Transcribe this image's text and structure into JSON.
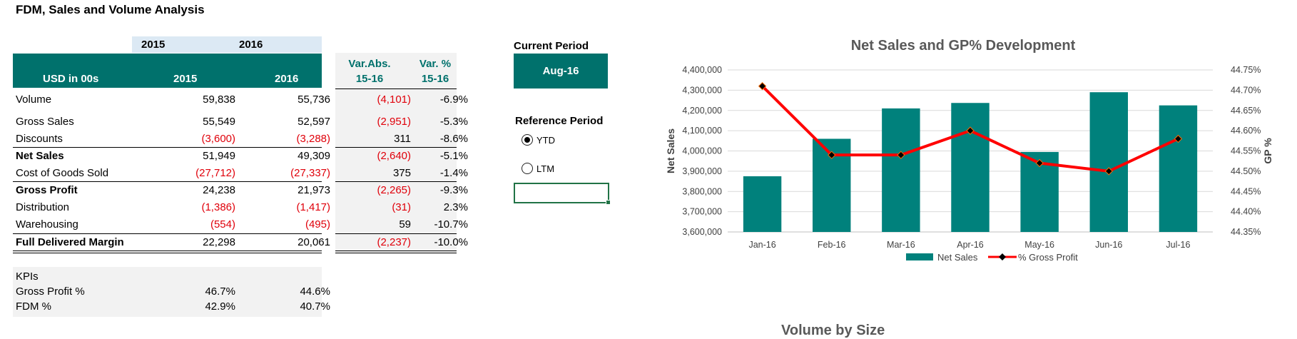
{
  "title": "FDM, Sales and Volume Analysis",
  "years": [
    "2015",
    "2016"
  ],
  "table": {
    "header": {
      "label": "USD in 00s",
      "col2015": "2015",
      "col2016": "2016"
    },
    "rows": [
      {
        "label": "Volume",
        "v2015": "59,838",
        "v2016": "55,736",
        "var_abs": "(4,101)",
        "var_pct": "-6.9%"
      },
      {
        "label": "Gross Sales",
        "v2015": "55,549",
        "v2016": "52,597",
        "var_abs": "(2,951)",
        "var_pct": "-5.3%"
      },
      {
        "label": "Discounts",
        "v2015": "(3,600)",
        "v2016": "(3,288)",
        "var_abs": "311",
        "var_pct": "-8.6%"
      },
      {
        "label": "Net Sales",
        "v2015": "51,949",
        "v2016": "49,309",
        "var_abs": "(2,640)",
        "var_pct": "-5.1%"
      },
      {
        "label": "Cost of Goods Sold",
        "v2015": "(27,712)",
        "v2016": "(27,337)",
        "var_abs": "375",
        "var_pct": "-1.4%"
      },
      {
        "label": "Gross Profit",
        "v2015": "24,238",
        "v2016": "21,973",
        "var_abs": "(2,265)",
        "var_pct": "-9.3%"
      },
      {
        "label": "Distribution",
        "v2015": "(1,386)",
        "v2016": "(1,417)",
        "var_abs": "(31)",
        "var_pct": "2.3%"
      },
      {
        "label": "Warehousing",
        "v2015": "(554)",
        "v2016": "(495)",
        "var_abs": "59",
        "var_pct": "-10.7%"
      },
      {
        "label": "Full Delivered Margin",
        "v2015": "22,298",
        "v2016": "20,061",
        "var_abs": "(2,237)",
        "var_pct": "-10.0%"
      }
    ]
  },
  "variance_header": {
    "abs_line1": "Var.Abs.",
    "abs_line2": "15-16",
    "pct_line1": "Var. %",
    "pct_line2": "15-16"
  },
  "kpis": {
    "title": "KPIs",
    "rows": [
      {
        "label": "Gross Profit %",
        "v2015": "46.7%",
        "v2016": "44.6%"
      },
      {
        "label": "FDM %",
        "v2015": "42.9%",
        "v2016": "40.7%"
      }
    ]
  },
  "current_period": {
    "label": "Current Period",
    "value": "Aug-16"
  },
  "reference_period": {
    "label": "Reference Period",
    "options": [
      "YTD",
      "LTM"
    ],
    "selected": "YTD"
  },
  "chart_data": {
    "type": "bar",
    "title": "Net Sales and GP% Development",
    "categories": [
      "Jan-16",
      "Feb-16",
      "Mar-16",
      "Apr-16",
      "May-16",
      "Jun-16",
      "Jul-16"
    ],
    "series": [
      {
        "name": "Net Sales",
        "type": "bar",
        "axis": "left",
        "color": "#00817c",
        "values": [
          3875000,
          4060000,
          4210000,
          4237000,
          3995000,
          4290000,
          4225000
        ]
      },
      {
        "name": "% Gross Profit",
        "type": "line",
        "axis": "right",
        "color": "#ff0000",
        "values": [
          44.71,
          44.54,
          44.54,
          44.6,
          44.52,
          44.5,
          44.58
        ]
      }
    ],
    "ylabel": "Net Sales",
    "y2label": "GP %",
    "ylim": [
      3600000,
      4400000
    ],
    "y2lim": [
      44.35,
      44.75
    ],
    "yticks": [
      "4,400,000",
      "4,300,000",
      "4,200,000",
      "4,100,000",
      "4,000,000",
      "3,900,000",
      "3,800,000",
      "3,700,000",
      "3,600,000"
    ],
    "y2ticks": [
      "44.75%",
      "44.70%",
      "44.65%",
      "44.60%",
      "44.55%",
      "44.50%",
      "44.45%",
      "44.40%",
      "44.35%"
    ],
    "grid": true,
    "legend": "bottom"
  },
  "second_chart_title": "Volume by Size"
}
